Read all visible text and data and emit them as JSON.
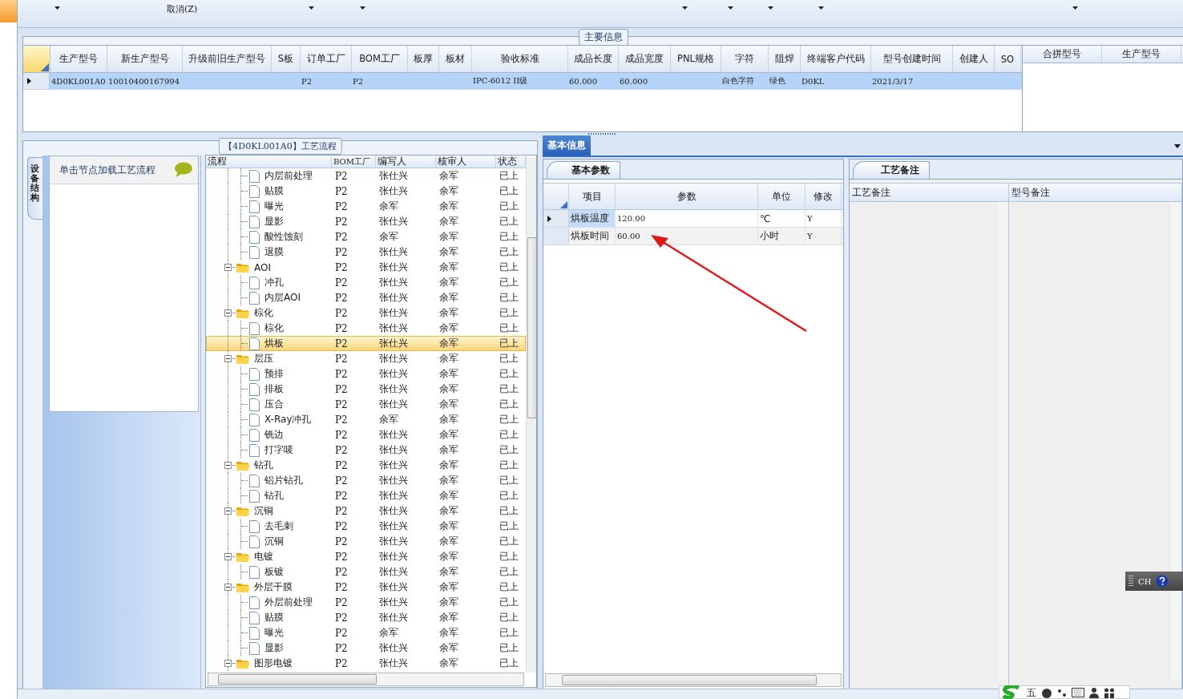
{
  "toolbar": {
    "cancel_label": "取消(Z)"
  },
  "main_info": {
    "title": "主要信息",
    "columns": [
      "生产型号",
      "新生产型号",
      "升级前旧生产型号",
      "S板",
      "订单工厂",
      "BOM工厂",
      "板厚",
      "板材",
      "验收标准",
      "成品长度",
      "成品宽度",
      "PNL规格",
      "字符",
      "阻焊",
      "终端客户代码",
      "型号创建时间",
      "创建人",
      "SO"
    ],
    "rows": [
      {
        "selected": true,
        "cells": [
          "4D0KL001A0",
          "10010400167994",
          null,
          null,
          "P2",
          "P2",
          null,
          null,
          "IPC-6012 II级",
          "60.000",
          "60.000",
          null,
          "白色字符",
          "绿色",
          "D0KL",
          "2021/3/17",
          null,
          null
        ]
      }
    ]
  },
  "merge_table": {
    "columns": [
      "合拼型号",
      "生产型号"
    ]
  },
  "process": {
    "title": "【4D0KL001A0】工艺流程",
    "side_tab": "设备结构",
    "hint": "单击节点加载工艺流程",
    "columns": [
      "流程",
      "BOM工厂",
      "编写人",
      "核审人",
      "状态"
    ],
    "tree": [
      {
        "kind": "leaf",
        "label": "内层前处理",
        "bom": "P2",
        "author": "张仕兴",
        "reviewer": "余军",
        "status": "已上",
        "selected": false
      },
      {
        "kind": "leaf",
        "label": "贴膜",
        "bom": "P2",
        "author": "张仕兴",
        "reviewer": "余军",
        "status": "已上",
        "selected": false
      },
      {
        "kind": "leaf",
        "label": "曝光",
        "bom": "P2",
        "author": "余军",
        "reviewer": "余军",
        "status": "已上",
        "selected": false
      },
      {
        "kind": "leaf",
        "label": "显影",
        "bom": "P2",
        "author": "张仕兴",
        "reviewer": "余军",
        "status": "已上",
        "selected": false
      },
      {
        "kind": "leaf",
        "label": "酸性蚀刻",
        "bom": "P2",
        "author": "余军",
        "reviewer": "余军",
        "status": "已上",
        "selected": false
      },
      {
        "kind": "leaf",
        "label": "退膜",
        "bom": "P2",
        "author": "张仕兴",
        "reviewer": "余军",
        "status": "已上",
        "selected": false
      },
      {
        "kind": "folder",
        "label": "AOI",
        "bom": "P2",
        "author": "张仕兴",
        "reviewer": "余军",
        "status": "已上",
        "selected": false,
        "expanded": true,
        "children": [
          {
            "kind": "leaf",
            "label": "冲孔",
            "bom": "P2",
            "author": "张仕兴",
            "reviewer": "余军",
            "status": "已上",
            "selected": false
          },
          {
            "kind": "leaf",
            "label": "内层AOI",
            "bom": "P2",
            "author": "张仕兴",
            "reviewer": "余军",
            "status": "已上",
            "selected": false
          }
        ]
      },
      {
        "kind": "folder",
        "label": "棕化",
        "bom": "P2",
        "author": "张仕兴",
        "reviewer": "余军",
        "status": "已上",
        "selected": false,
        "expanded": true,
        "children": [
          {
            "kind": "leaf",
            "label": "棕化",
            "bom": "P2",
            "author": "张仕兴",
            "reviewer": "余军",
            "status": "已上",
            "selected": false
          },
          {
            "kind": "leaf",
            "label": "烘板",
            "bom": "P2",
            "author": "张仕兴",
            "reviewer": "余军",
            "status": "已上",
            "selected": true
          }
        ]
      },
      {
        "kind": "folder",
        "label": "层压",
        "bom": "P2",
        "author": "张仕兴",
        "reviewer": "余军",
        "status": "已上",
        "selected": false,
        "expanded": true,
        "children": [
          {
            "kind": "leaf",
            "label": "预排",
            "bom": "P2",
            "author": "张仕兴",
            "reviewer": "余军",
            "status": "已上",
            "selected": false
          },
          {
            "kind": "leaf",
            "label": "排板",
            "bom": "P2",
            "author": "张仕兴",
            "reviewer": "余军",
            "status": "已上",
            "selected": false
          },
          {
            "kind": "leaf",
            "label": "压合",
            "bom": "P2",
            "author": "张仕兴",
            "reviewer": "余军",
            "status": "已上",
            "selected": false
          },
          {
            "kind": "leaf",
            "label": "X-Ray冲孔",
            "bom": "P2",
            "author": "余军",
            "reviewer": "余军",
            "status": "已上",
            "selected": false
          },
          {
            "kind": "leaf",
            "label": "铣边",
            "bom": "P2",
            "author": "张仕兴",
            "reviewer": "余军",
            "status": "已上",
            "selected": false
          },
          {
            "kind": "leaf",
            "label": "打字唛",
            "bom": "P2",
            "author": "张仕兴",
            "reviewer": "余军",
            "status": "已上",
            "selected": false
          }
        ]
      },
      {
        "kind": "folder",
        "label": "钻孔",
        "bom": "P2",
        "author": "张仕兴",
        "reviewer": "余军",
        "status": "已上",
        "selected": false,
        "expanded": true,
        "children": [
          {
            "kind": "leaf",
            "label": "铝片钻孔",
            "bom": "P2",
            "author": "张仕兴",
            "reviewer": "余军",
            "status": "已上",
            "selected": false
          },
          {
            "kind": "leaf",
            "label": "钻孔",
            "bom": "P2",
            "author": "张仕兴",
            "reviewer": "余军",
            "status": "已上",
            "selected": false
          }
        ]
      },
      {
        "kind": "folder",
        "label": "沉铜",
        "bom": "P2",
        "author": "张仕兴",
        "reviewer": "余军",
        "status": "已上",
        "selected": false,
        "expanded": true,
        "children": [
          {
            "kind": "leaf",
            "label": "去毛刺",
            "bom": "P2",
            "author": "张仕兴",
            "reviewer": "余军",
            "status": "已上",
            "selected": false
          },
          {
            "kind": "leaf",
            "label": "沉铜",
            "bom": "P2",
            "author": "张仕兴",
            "reviewer": "余军",
            "status": "已上",
            "selected": false
          }
        ]
      },
      {
        "kind": "folder",
        "label": "电镀",
        "bom": "P2",
        "author": "张仕兴",
        "reviewer": "余军",
        "status": "已上",
        "selected": false,
        "expanded": true,
        "children": [
          {
            "kind": "leaf",
            "label": "板镀",
            "bom": "P2",
            "author": "张仕兴",
            "reviewer": "余军",
            "status": "已上",
            "selected": false
          }
        ]
      },
      {
        "kind": "folder",
        "label": "外层干膜",
        "bom": "P2",
        "author": "张仕兴",
        "reviewer": "余军",
        "status": "已上",
        "selected": false,
        "expanded": true,
        "children": [
          {
            "kind": "leaf",
            "label": "外层前处理",
            "bom": "P2",
            "author": "张仕兴",
            "reviewer": "余军",
            "status": "已上",
            "selected": false
          },
          {
            "kind": "leaf",
            "label": "贴膜",
            "bom": "P2",
            "author": "张仕兴",
            "reviewer": "余军",
            "status": "已上",
            "selected": false
          },
          {
            "kind": "leaf",
            "label": "曝光",
            "bom": "P2",
            "author": "余军",
            "reviewer": "余军",
            "status": "已上",
            "selected": false
          },
          {
            "kind": "leaf",
            "label": "显影",
            "bom": "P2",
            "author": "张仕兴",
            "reviewer": "余军",
            "status": "已上",
            "selected": false
          }
        ]
      },
      {
        "kind": "folder",
        "label": "图形电镀",
        "bom": "P2",
        "author": "张仕兴",
        "reviewer": "余军",
        "status": "已上",
        "selected": false,
        "expanded": true
      }
    ]
  },
  "basic_info": {
    "tab": "基本信息",
    "params_tab": "基本参数",
    "params_columns": [
      "项目",
      "参数",
      "单位",
      "修改"
    ],
    "params": [
      {
        "item": "烘板温度",
        "value": "120.00",
        "unit": "℃",
        "modify": "Y",
        "selected": true
      },
      {
        "item": "烘板时间",
        "value": "60.00",
        "unit": "小时",
        "modify": "Y",
        "selected": false
      }
    ],
    "notes_tab": "工艺备注",
    "notes_columns": [
      "工艺备注",
      "型号备注"
    ]
  },
  "language_bar": {
    "label": "CH"
  },
  "ime_bar": {
    "mode": "五"
  }
}
